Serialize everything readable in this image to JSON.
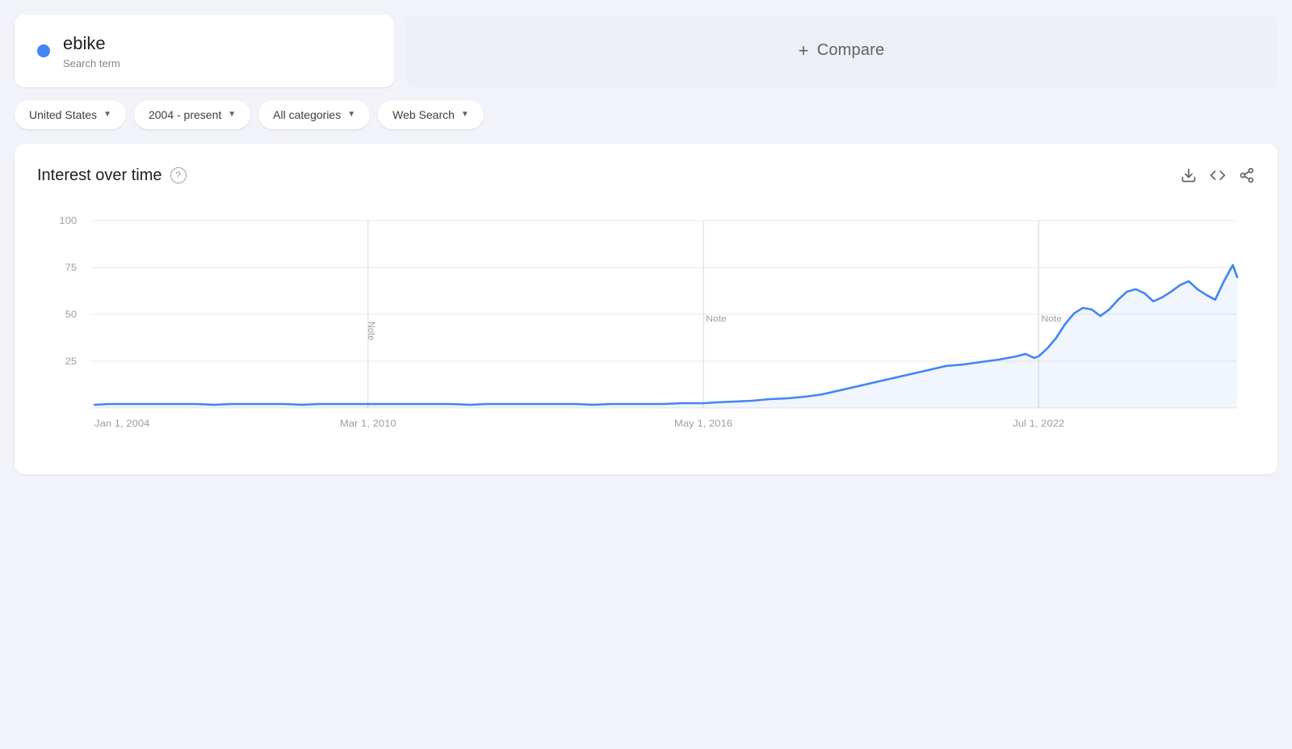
{
  "search_term": {
    "name": "ebike",
    "label": "Search term",
    "dot_color": "#4285f4"
  },
  "compare": {
    "label": "Compare",
    "plus": "+"
  },
  "filters": [
    {
      "id": "region",
      "label": "United States"
    },
    {
      "id": "time",
      "label": "2004 - present"
    },
    {
      "id": "category",
      "label": "All categories"
    },
    {
      "id": "search_type",
      "label": "Web Search"
    }
  ],
  "chart": {
    "title": "Interest over time",
    "help_label": "?",
    "y_axis": [
      "100",
      "75",
      "50",
      "25"
    ],
    "x_axis": [
      "Jan 1, 2004",
      "Mar 1, 2010",
      "May 1, 2016",
      "Jul 1, 2022"
    ],
    "notes": [
      {
        "label": "Note",
        "x_position": 0.275
      },
      {
        "label": "Note",
        "x_position": 0.548
      },
      {
        "label": "Note",
        "x_position": 0.826
      }
    ],
    "actions": {
      "download": "⬇",
      "embed": "<>",
      "share": "⤢"
    }
  }
}
